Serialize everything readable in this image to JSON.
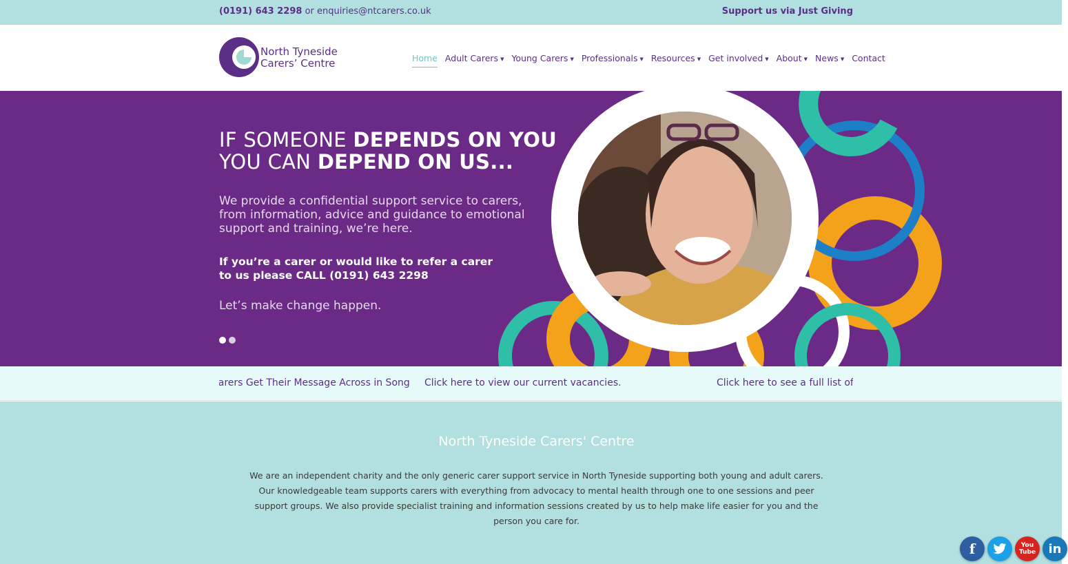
{
  "topbar": {
    "phone": "(0191) 643 2298",
    "separator": "or",
    "email": "enquiries@ntcarers.co.uk",
    "support": "Support us via Just Giving"
  },
  "logo": {
    "line1": "North Tyneside",
    "line2": "Carers’ Centre"
  },
  "nav": {
    "items": [
      {
        "label": "Home",
        "active": true,
        "dropdown": false
      },
      {
        "label": "Adult Carers",
        "dropdown": true
      },
      {
        "label": "Young Carers",
        "dropdown": true
      },
      {
        "label": "Professionals",
        "dropdown": true
      },
      {
        "label": "Resources",
        "dropdown": true
      },
      {
        "label": "Get involved",
        "dropdown": true
      },
      {
        "label": "About",
        "dropdown": true
      },
      {
        "label": "News",
        "dropdown": true
      },
      {
        "label": "Contact",
        "dropdown": false
      }
    ]
  },
  "hero": {
    "headline_line1_light": "IF SOMEONE ",
    "headline_line1_bold": "DEPENDS ON YOU",
    "headline_line2_light": "YOU CAN ",
    "headline_line2_bold": "DEPEND ON US...",
    "intro": "We provide a confidential support service to carers, from information, advice and guidance to emotional support and training, we’re here.",
    "cta_line1": "If you’re a carer or would like to refer a carer",
    "cta_line2": "to us please CALL (0191) 643 2298",
    "tagline": "Let’s make change happen.",
    "slides": 2,
    "active_slide": 1
  },
  "ticker": {
    "items": [
      "Carers Get Their Message Across in Song",
      "Click here to view our current vacancies.",
      "Click here to see a full list of o"
    ]
  },
  "about": {
    "title": "North Tyneside Carers' Centre",
    "body": "We are an independent charity and the only generic carer support service in North Tyneside supporting both young and adult carers. Our knowledgeable team supports carers with everything from advocacy to mental health through one to one sessions and peer support groups. We also provide specialist training and information sessions created by us to help make life easier for you and the person you care for."
  },
  "social": {
    "facebook": "f",
    "twitter": "t",
    "youtube_line1": "You",
    "youtube_line2": "Tube",
    "linkedin": "in"
  },
  "colors": {
    "brand_purple": "#5b2f86",
    "hero_purple": "#6b2a86",
    "teal_light": "#b2dfdf",
    "teal": "#2fbfa8",
    "orange": "#f5a21b",
    "blue": "#1e7fc9"
  }
}
